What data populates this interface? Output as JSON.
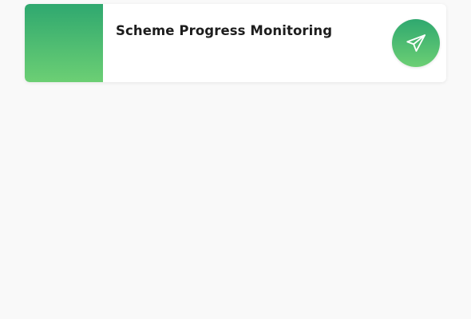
{
  "card": {
    "title": "Scheme Progress Monitoring",
    "thumbnail_colors": [
      "#2fa86f",
      "#6ccf74"
    ],
    "action_icon": "send-icon"
  }
}
